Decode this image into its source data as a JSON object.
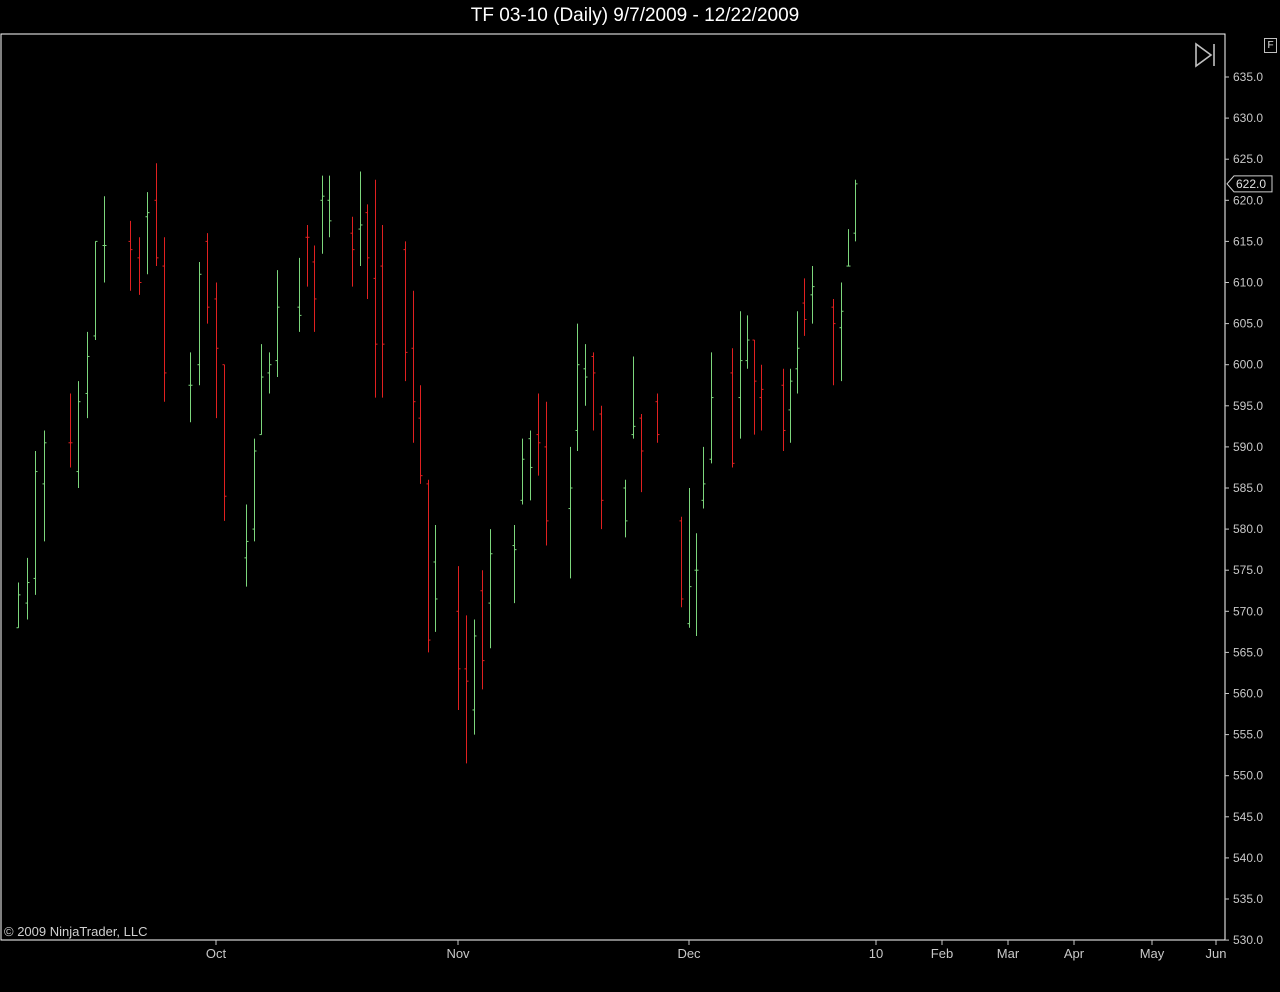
{
  "header": {
    "title": "TF 03-10 (Daily)  9/7/2009 - 12/22/2009"
  },
  "footer": {
    "copyright": "© 2009 NinjaTrader, LLC"
  },
  "controls": {
    "f_label": "F"
  },
  "colors": {
    "up": "#7cd67c",
    "down": "#e02020",
    "background": "#000000",
    "axis": "#ffffff"
  },
  "icons": {
    "scroll_end": "scroll-to-end-icon"
  },
  "chart_data": {
    "type": "ohlc",
    "title": "TF 03-10 (Daily)  9/7/2009 - 12/22/2009",
    "ylim": [
      530,
      638
    ],
    "yticks": [
      635,
      630,
      625,
      620,
      615,
      610,
      605,
      600,
      595,
      590,
      585,
      580,
      575,
      570,
      565,
      560,
      555,
      550,
      545,
      540,
      535,
      530
    ],
    "ytick_labels": [
      "635.0",
      "630.0",
      "625.0",
      "620.0",
      "615.0",
      "610.0",
      "605.0",
      "600.0",
      "595.0",
      "590.0",
      "585.0",
      "580.0",
      "575.0",
      "570.0",
      "565.0",
      "560.0",
      "555.0",
      "550.0",
      "545.0",
      "540.0",
      "535.0",
      "530.0"
    ],
    "xtick_labels": [
      {
        "label": "Oct",
        "at": "2009-10-01"
      },
      {
        "label": "Nov",
        "at": "2009-11-02"
      },
      {
        "label": "Dec",
        "at": "2009-12-01"
      },
      {
        "label": "10",
        "at": "2010-01-04"
      },
      {
        "label": "Feb",
        "at": "2010-02-01"
      },
      {
        "label": "Mar",
        "at": "2010-03-01"
      },
      {
        "label": "Apr",
        "at": "2010-04-01"
      },
      {
        "label": "May",
        "at": "2010-05-03"
      },
      {
        "label": "Jun",
        "at": "2010-06-01"
      }
    ],
    "last_price": 622.0,
    "last_price_label": "622.0",
    "bars": [
      {
        "date": "2009-09-08",
        "o": 568.0,
        "h": 573.5,
        "l": 568.0,
        "c": 572.0,
        "dir": "up"
      },
      {
        "date": "2009-09-09",
        "o": 571.0,
        "h": 576.5,
        "l": 569.0,
        "c": 573.5,
        "dir": "up"
      },
      {
        "date": "2009-09-10",
        "o": 574.0,
        "h": 589.5,
        "l": 572.0,
        "c": 587.0,
        "dir": "up"
      },
      {
        "date": "2009-09-11",
        "o": 585.5,
        "h": 592.0,
        "l": 578.5,
        "c": 590.5,
        "dir": "up"
      },
      {
        "date": "2009-09-14",
        "o": 590.5,
        "h": 596.5,
        "l": 587.5,
        "c": 590.5,
        "dir": "down"
      },
      {
        "date": "2009-09-15",
        "o": 587.0,
        "h": 598.0,
        "l": 585.0,
        "c": 595.5,
        "dir": "up"
      },
      {
        "date": "2009-09-16",
        "o": 596.5,
        "h": 604.0,
        "l": 593.5,
        "c": 601.0,
        "dir": "up"
      },
      {
        "date": "2009-09-17",
        "o": 603.5,
        "h": 615.0,
        "l": 603.0,
        "c": 615.0,
        "dir": "up"
      },
      {
        "date": "2009-09-18",
        "o": 614.5,
        "h": 620.5,
        "l": 610.0,
        "c": 614.5,
        "dir": "up"
      },
      {
        "date": "2009-09-21",
        "o": 615.0,
        "h": 617.5,
        "l": 609.0,
        "c": 614.0,
        "dir": "down"
      },
      {
        "date": "2009-09-22",
        "o": 613.0,
        "h": 615.5,
        "l": 608.5,
        "c": 610.0,
        "dir": "down"
      },
      {
        "date": "2009-09-23",
        "o": 618.0,
        "h": 621.0,
        "l": 611.0,
        "c": 618.5,
        "dir": "up"
      },
      {
        "date": "2009-09-24",
        "o": 620.0,
        "h": 624.5,
        "l": 612.0,
        "c": 613.0,
        "dir": "down"
      },
      {
        "date": "2009-09-25",
        "o": 612.0,
        "h": 615.5,
        "l": 595.5,
        "c": 599.0,
        "dir": "down"
      },
      {
        "date": "2009-09-28",
        "o": 597.5,
        "h": 601.5,
        "l": 593.0,
        "c": 597.5,
        "dir": "up"
      },
      {
        "date": "2009-09-29",
        "o": 600.0,
        "h": 612.5,
        "l": 597.5,
        "c": 611.0,
        "dir": "up"
      },
      {
        "date": "2009-09-30",
        "o": 615.0,
        "h": 616.0,
        "l": 605.0,
        "c": 607.0,
        "dir": "down"
      },
      {
        "date": "2009-10-01",
        "o": 608.0,
        "h": 610.0,
        "l": 593.5,
        "c": 602.0,
        "dir": "down"
      },
      {
        "date": "2009-10-02",
        "o": 600.0,
        "h": 600.0,
        "l": 581.0,
        "c": 584.0,
        "dir": "down"
      },
      {
        "date": "2009-10-05",
        "o": 576.5,
        "h": 583.0,
        "l": 573.0,
        "c": 578.5,
        "dir": "up"
      },
      {
        "date": "2009-10-06",
        "o": 580.0,
        "h": 591.0,
        "l": 578.5,
        "c": 589.5,
        "dir": "up"
      },
      {
        "date": "2009-10-07",
        "o": 591.5,
        "h": 602.5,
        "l": 591.5,
        "c": 598.5,
        "dir": "up"
      },
      {
        "date": "2009-10-08",
        "o": 599.0,
        "h": 601.5,
        "l": 596.5,
        "c": 600.0,
        "dir": "up"
      },
      {
        "date": "2009-10-09",
        "o": 600.5,
        "h": 611.5,
        "l": 598.5,
        "c": 607.0,
        "dir": "up"
      },
      {
        "date": "2009-10-12",
        "o": 607.0,
        "h": 613.0,
        "l": 604.0,
        "c": 606.0,
        "dir": "up"
      },
      {
        "date": "2009-10-13",
        "o": 615.5,
        "h": 617.0,
        "l": 609.5,
        "c": 615.5,
        "dir": "down"
      },
      {
        "date": "2009-10-14",
        "o": 612.5,
        "h": 614.5,
        "l": 604.0,
        "c": 608.0,
        "dir": "down"
      },
      {
        "date": "2009-10-15",
        "o": 620.0,
        "h": 623.0,
        "l": 613.5,
        "c": 620.5,
        "dir": "up"
      },
      {
        "date": "2009-10-16",
        "o": 620.0,
        "h": 623.0,
        "l": 615.5,
        "c": 617.5,
        "dir": "up"
      },
      {
        "date": "2009-10-19",
        "o": 616.0,
        "h": 618.0,
        "l": 609.5,
        "c": 614.0,
        "dir": "down"
      },
      {
        "date": "2009-10-20",
        "o": 616.5,
        "h": 623.5,
        "l": 612.0,
        "c": 617.0,
        "dir": "up"
      },
      {
        "date": "2009-10-21",
        "o": 618.5,
        "h": 619.5,
        "l": 608.0,
        "c": 613.0,
        "dir": "down"
      },
      {
        "date": "2009-10-22",
        "o": 610.5,
        "h": 622.5,
        "l": 596.0,
        "c": 602.5,
        "dir": "down"
      },
      {
        "date": "2009-10-23",
        "o": 612.0,
        "h": 617.0,
        "l": 596.0,
        "c": 602.5,
        "dir": "down"
      },
      {
        "date": "2009-10-26",
        "o": 614.0,
        "h": 615.0,
        "l": 598.0,
        "c": 601.5,
        "dir": "down"
      },
      {
        "date": "2009-10-27",
        "o": 602.0,
        "h": 609.0,
        "l": 590.5,
        "c": 595.5,
        "dir": "down"
      },
      {
        "date": "2009-10-28",
        "o": 593.5,
        "h": 597.5,
        "l": 585.5,
        "c": 586.5,
        "dir": "down"
      },
      {
        "date": "2009-10-29",
        "o": 585.5,
        "h": 586.0,
        "l": 565.0,
        "c": 566.5,
        "dir": "down"
      },
      {
        "date": "2009-10-30",
        "o": 576.0,
        "h": 580.5,
        "l": 567.5,
        "c": 571.5,
        "dir": "up"
      },
      {
        "date": "2009-11-02",
        "o": 570.0,
        "h": 575.5,
        "l": 558.0,
        "c": 563.0,
        "dir": "down"
      },
      {
        "date": "2009-11-03",
        "o": 563.0,
        "h": 569.5,
        "l": 551.5,
        "c": 561.5,
        "dir": "down"
      },
      {
        "date": "2009-11-04",
        "o": 558.0,
        "h": 569.0,
        "l": 555.0,
        "c": 567.0,
        "dir": "up"
      },
      {
        "date": "2009-11-05",
        "o": 572.5,
        "h": 575.0,
        "l": 560.5,
        "c": 564.0,
        "dir": "down"
      },
      {
        "date": "2009-11-06",
        "o": 571.0,
        "h": 580.0,
        "l": 565.5,
        "c": 577.0,
        "dir": "up"
      },
      {
        "date": "2009-11-09",
        "o": 578.0,
        "h": 580.5,
        "l": 571.0,
        "c": 577.5,
        "dir": "up"
      },
      {
        "date": "2009-11-10",
        "o": 583.5,
        "h": 591.0,
        "l": 583.0,
        "c": 588.5,
        "dir": "up"
      },
      {
        "date": "2009-11-11",
        "o": 591.0,
        "h": 592.0,
        "l": 583.5,
        "c": 587.5,
        "dir": "up"
      },
      {
        "date": "2009-11-12",
        "o": 591.5,
        "h": 596.5,
        "l": 586.5,
        "c": 590.5,
        "dir": "down"
      },
      {
        "date": "2009-11-13",
        "o": 590.0,
        "h": 595.5,
        "l": 578.0,
        "c": 581.0,
        "dir": "down"
      },
      {
        "date": "2009-11-16",
        "o": 582.5,
        "h": 590.0,
        "l": 574.0,
        "c": 585.0,
        "dir": "up"
      },
      {
        "date": "2009-11-17",
        "o": 592.0,
        "h": 605.0,
        "l": 589.5,
        "c": 600.0,
        "dir": "up"
      },
      {
        "date": "2009-11-18",
        "o": 599.5,
        "h": 602.5,
        "l": 595.0,
        "c": 598.5,
        "dir": "up"
      },
      {
        "date": "2009-11-19",
        "o": 601.0,
        "h": 601.5,
        "l": 592.0,
        "c": 599.0,
        "dir": "down"
      },
      {
        "date": "2009-11-20",
        "o": 594.0,
        "h": 595.0,
        "l": 580.0,
        "c": 583.5,
        "dir": "down"
      },
      {
        "date": "2009-11-23",
        "o": 585.0,
        "h": 586.0,
        "l": 579.0,
        "c": 581.0,
        "dir": "up"
      },
      {
        "date": "2009-11-24",
        "o": 591.5,
        "h": 601.0,
        "l": 591.0,
        "c": 592.5,
        "dir": "up"
      },
      {
        "date": "2009-11-25",
        "o": 593.5,
        "h": 594.0,
        "l": 584.5,
        "c": 589.5,
        "dir": "down"
      },
      {
        "date": "2009-11-27",
        "o": 595.5,
        "h": 596.5,
        "l": 590.5,
        "c": 591.5,
        "dir": "down"
      },
      {
        "date": "2009-11-30",
        "o": 581.0,
        "h": 581.5,
        "l": 570.5,
        "c": 571.5,
        "dir": "down"
      },
      {
        "date": "2009-12-01",
        "o": 568.5,
        "h": 585.0,
        "l": 568.0,
        "c": 573.0,
        "dir": "up"
      },
      {
        "date": "2009-12-02",
        "o": 575.0,
        "h": 579.5,
        "l": 567.0,
        "c": 575.0,
        "dir": "up"
      },
      {
        "date": "2009-12-03",
        "o": 583.5,
        "h": 590.0,
        "l": 582.5,
        "c": 585.5,
        "dir": "up"
      },
      {
        "date": "2009-12-04",
        "o": 588.5,
        "h": 601.5,
        "l": 588.0,
        "c": 596.0,
        "dir": "up"
      },
      {
        "date": "2009-12-07",
        "o": 599.0,
        "h": 602.0,
        "l": 587.5,
        "c": 588.0,
        "dir": "down"
      },
      {
        "date": "2009-12-08",
        "o": 596.0,
        "h": 606.5,
        "l": 591.0,
        "c": 600.5,
        "dir": "up"
      },
      {
        "date": "2009-12-09",
        "o": 600.5,
        "h": 606.0,
        "l": 599.5,
        "c": 603.0,
        "dir": "up"
      },
      {
        "date": "2009-12-10",
        "o": 603.0,
        "h": 603.0,
        "l": 591.5,
        "c": 598.0,
        "dir": "down"
      },
      {
        "date": "2009-12-11",
        "o": 596.0,
        "h": 600.0,
        "l": 592.0,
        "c": 597.0,
        "dir": "down"
      },
      {
        "date": "2009-12-14",
        "o": 597.5,
        "h": 599.5,
        "l": 589.5,
        "c": 592.0,
        "dir": "down"
      },
      {
        "date": "2009-12-15",
        "o": 594.5,
        "h": 599.5,
        "l": 590.5,
        "c": 598.0,
        "dir": "up"
      },
      {
        "date": "2009-12-16",
        "o": 599.5,
        "h": 606.5,
        "l": 596.5,
        "c": 602.0,
        "dir": "up"
      },
      {
        "date": "2009-12-17",
        "o": 607.5,
        "h": 610.5,
        "l": 603.5,
        "c": 605.5,
        "dir": "down"
      },
      {
        "date": "2009-12-18",
        "o": 608.5,
        "h": 612.0,
        "l": 605.0,
        "c": 609.5,
        "dir": "up"
      },
      {
        "date": "2009-12-21",
        "o": 607.0,
        "h": 608.0,
        "l": 597.5,
        "c": 605.0,
        "dir": "down"
      },
      {
        "date": "2009-12-22",
        "o": 604.5,
        "h": 610.0,
        "l": 598.0,
        "c": 606.5,
        "dir": "up"
      },
      {
        "date": "2009-12-23",
        "o": 612.0,
        "h": 616.5,
        "l": 612.0,
        "c": 612.0,
        "dir": "up"
      },
      {
        "date": "2009-12-24",
        "o": 616.0,
        "h": 622.5,
        "l": 615.0,
        "c": 622.0,
        "dir": "up"
      }
    ]
  }
}
